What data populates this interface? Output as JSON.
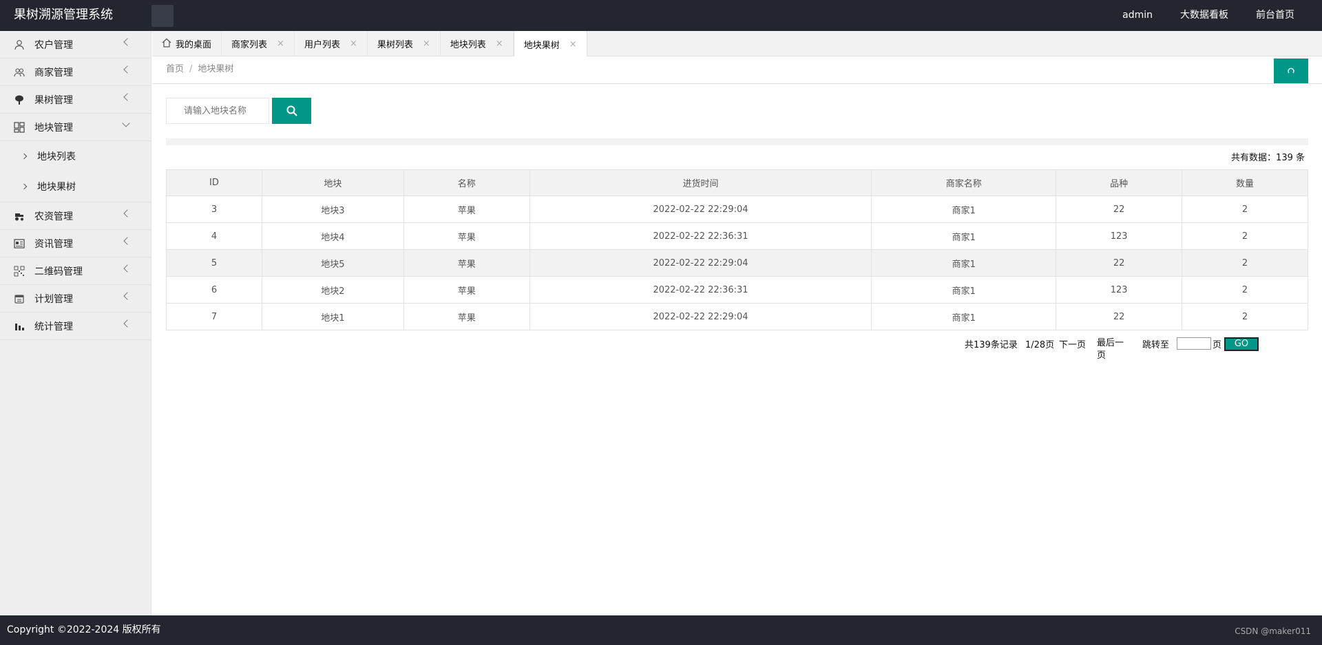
{
  "header": {
    "title": "果树溯源管理系统",
    "nav": [
      "admin",
      "大数据看板",
      "前台首页"
    ]
  },
  "sidebar": {
    "items": [
      {
        "label": "农户管理",
        "icon": "user-icon"
      },
      {
        "label": "商家管理",
        "icon": "users-icon"
      },
      {
        "label": "果树管理",
        "icon": "tree-icon"
      },
      {
        "label": "地块管理",
        "icon": "grid-icon",
        "open": true,
        "children": [
          "地块列表",
          "地块果树"
        ]
      },
      {
        "label": "农资管理",
        "icon": "tractor-icon"
      },
      {
        "label": "资讯管理",
        "icon": "news-icon"
      },
      {
        "label": "二维码管理",
        "icon": "qrcode-icon"
      },
      {
        "label": "计划管理",
        "icon": "calendar-icon"
      },
      {
        "label": "统计管理",
        "icon": "bar-chart-icon"
      }
    ]
  },
  "tabs": [
    {
      "label": "我的桌面",
      "home": true
    },
    {
      "label": "商家列表",
      "close": "×"
    },
    {
      "label": "用户列表",
      "close": "×"
    },
    {
      "label": "果树列表",
      "close": "×"
    },
    {
      "label": "地块列表",
      "close": "×"
    },
    {
      "label": "地块果树",
      "close": "×",
      "active": true
    }
  ],
  "breadcrumb": {
    "home": "首页",
    "sep": "/",
    "current": "地块果树"
  },
  "search": {
    "placeholder": "请输入地块名称"
  },
  "total_text": "共有数据：139 条",
  "table": {
    "headers": [
      "ID",
      "地块",
      "名称",
      "进货时间",
      "商家名称",
      "品种",
      "数量"
    ],
    "rows": [
      [
        "3",
        "地块3",
        "苹果",
        "2022-02-22 22:29:04",
        "商家1",
        "22",
        "2"
      ],
      [
        "4",
        "地块4",
        "苹果",
        "2022-02-22 22:36:31",
        "商家1",
        "123",
        "2"
      ],
      [
        "5",
        "地块5",
        "苹果",
        "2022-02-22 22:29:04",
        "商家1",
        "22",
        "2"
      ],
      [
        "6",
        "地块2",
        "苹果",
        "2022-02-22 22:36:31",
        "商家1",
        "123",
        "2"
      ],
      [
        "7",
        "地块1",
        "苹果",
        "2022-02-22 22:29:04",
        "商家1",
        "22",
        "2"
      ]
    ]
  },
  "pager": {
    "records": "共139条记录",
    "pages": "1/28页",
    "next": "下一页",
    "last": "最后一页",
    "jump_to": "跳转至",
    "page_unit": "页",
    "go": "GO"
  },
  "footer": {
    "copyright": "Copyright ©2022-2024 版权所有",
    "watermark": "CSDN @maker011"
  },
  "colors": {
    "accent": "#009688",
    "header_bg": "#23262e"
  }
}
